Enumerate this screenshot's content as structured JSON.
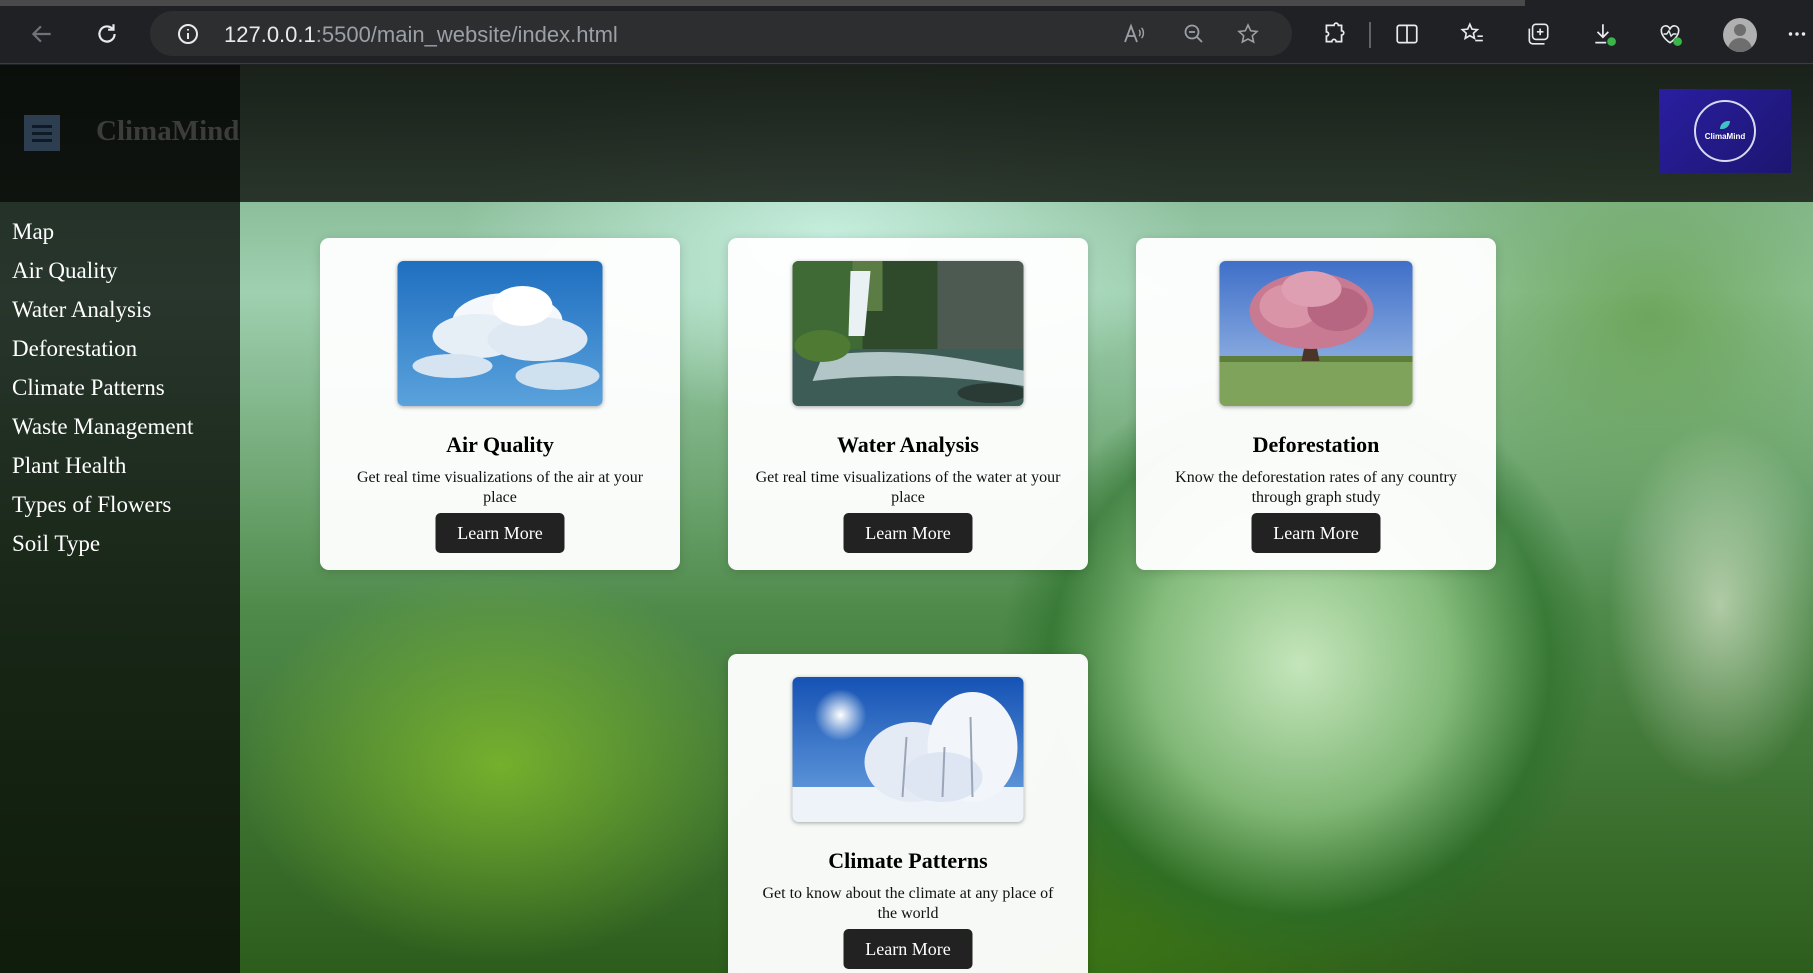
{
  "browser": {
    "url_host": "127.0.0.1",
    "url_rest": ":5500/main_website/index.html"
  },
  "site": {
    "brand": "ClimaMind",
    "logo_text": "ClimaMind"
  },
  "sidebar": {
    "items": [
      {
        "label": "Map"
      },
      {
        "label": "Air Quality"
      },
      {
        "label": "Water Analysis"
      },
      {
        "label": "Deforestation"
      },
      {
        "label": "Climate Patterns"
      },
      {
        "label": "Waste Management"
      },
      {
        "label": "Plant Health"
      },
      {
        "label": "Types of Flowers"
      },
      {
        "label": "Soil Type"
      }
    ]
  },
  "cards": [
    {
      "title": "Air Quality",
      "description": "Get real time visualizations of the air at your place",
      "button": "Learn More",
      "image": "cloudy-sky-image"
    },
    {
      "title": "Water Analysis",
      "description": "Get real time visualizations of the water at your place",
      "button": "Learn More",
      "image": "waterfall-image"
    },
    {
      "title": "Deforestation",
      "description": "Know the deforestation rates of any country through graph study",
      "button": "Learn More",
      "image": "blossom-tree-image"
    },
    {
      "title": "Climate Patterns",
      "description": "Get to know about the climate at any place of the world",
      "button": "Learn More",
      "image": "snowy-trees-image"
    }
  ],
  "colors": {
    "card_button": "#222222",
    "logo_background": "#2a1ea0",
    "menu_button": "#2c3e50"
  }
}
